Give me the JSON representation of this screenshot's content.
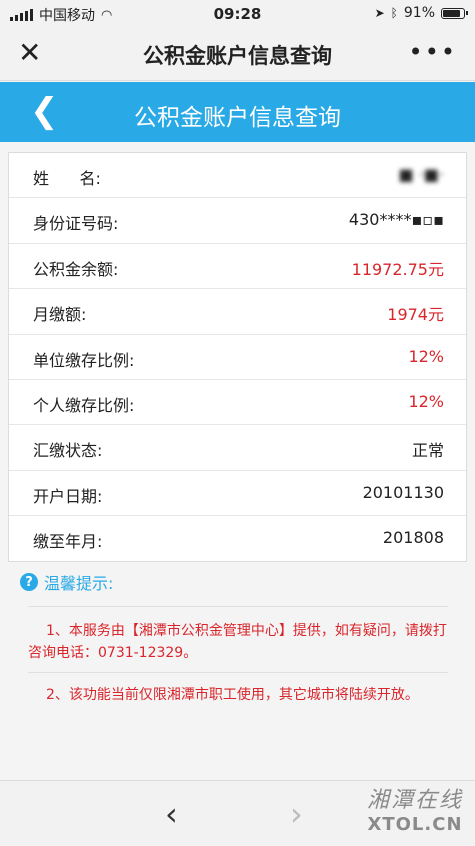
{
  "status_bar": {
    "carrier": "中国移动",
    "time": "09:28",
    "battery": "91%"
  },
  "wechat_bar": {
    "title": "公积金账户信息查询"
  },
  "header": {
    "title": "公积金账户信息查询"
  },
  "rows": [
    {
      "label": "姓      名:",
      "value": "■ ·■·"
    },
    {
      "label": "身份证号码:",
      "value": "430****▪▫▪"
    },
    {
      "label": "公积金余额:",
      "value": "11972.75元"
    },
    {
      "label": "月缴额:",
      "value": "1974元"
    },
    {
      "label": "单位缴存比例:",
      "value": "12%"
    },
    {
      "label": "个人缴存比例:",
      "value": "12%"
    },
    {
      "label": "汇缴状态:",
      "value": "正常"
    },
    {
      "label": "开户日期:",
      "value": "20101130"
    },
    {
      "label": "缴至年月:",
      "value": "201808"
    }
  ],
  "tips": {
    "title": "温馨提示:",
    "items": [
      "1、本服务由【湘潭市公积金管理中心】提供，如有疑问，请拨打咨询电话：0731-12329。",
      "2、该功能当前仅限湘潭市职工使用，其它城市将陆续开放。"
    ]
  },
  "watermark": {
    "cn": "湘潭在线",
    "en": "XTOL.CN"
  }
}
